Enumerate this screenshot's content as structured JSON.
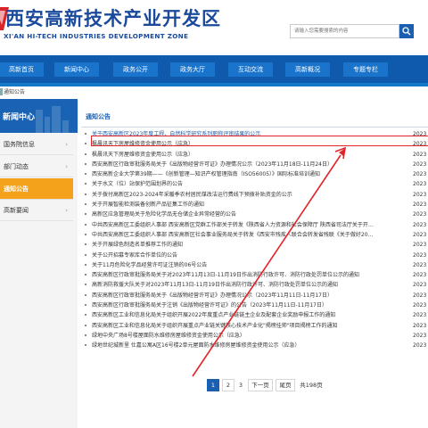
{
  "header": {
    "title_cn": "西安高新技术产业开发区",
    "title_en": "XI'AN HI-TECH INDUSTRIES DEVELOPMENT ZONE",
    "logo_icon": "emblem-icon"
  },
  "search": {
    "placeholder": "请输入您需要搜索的内容",
    "button_icon": "search-icon"
  },
  "nav": {
    "items": [
      {
        "label": "高新首页"
      },
      {
        "label": "新闻中心"
      },
      {
        "label": "政务公开"
      },
      {
        "label": "政务大厅"
      },
      {
        "label": "互动交流"
      },
      {
        "label": "高新概况"
      },
      {
        "label": "专题专栏"
      }
    ]
  },
  "breadcrumb": {
    "text": "通知公告"
  },
  "sidebar": {
    "banner_title": "新闻中心",
    "items": [
      {
        "label": "国务院信息",
        "arrow": "›",
        "active": false
      },
      {
        "label": "部门动态",
        "arrow": "›",
        "active": false
      },
      {
        "label": "通知公告",
        "arrow": "›",
        "active": true
      },
      {
        "label": "高新要闻",
        "arrow": "›",
        "active": false
      }
    ]
  },
  "main": {
    "section_title": "通知公告",
    "articles": [
      {
        "title": "关于西安高新区2023年度工程、自然科学研究系列职称评审结果的公示",
        "date": "2023",
        "highlight": true
      },
      {
        "title": "枫晨讯天下房屋维修资金使用公示（应急）",
        "date": "2023"
      },
      {
        "title": "枫晨讯天下房屋维修资金使用公示（应急）",
        "date": "2023"
      },
      {
        "title": "西安高新区行政审批服务局关于《出版物经营许可证》办理情况公示（2023年11月18日-11月24日）",
        "date": "2023"
      },
      {
        "title": "西安高新企业大学第39期——《创新管理—知识产权管理指南（ISO56005）》国际标准培训通知",
        "date": "2023"
      },
      {
        "title": "关于水文（位）站保护范围划界的公告",
        "date": "2023"
      },
      {
        "title": "关于拨付高新区2023-2024年采暖季农村居民煤改洁运行费线下预拨补贴资金的公示",
        "date": "2023"
      },
      {
        "title": "关于开展智能检测装备创新产品征集工作的通知",
        "date": "2023"
      },
      {
        "title": "高新区应急管理局关于危险化学品无仓储企业异常经营的公告",
        "date": "2023"
      },
      {
        "title": "中共西安高新区工委组织人事部 西安高新区党群工作部关于转发《陕西省人力资源和社会保障厅 陕西省司法厅关于开…",
        "date": "2023"
      },
      {
        "title": "中共西安高新区工委组织人事部 西安高新区社会事业服务局关于转发《西安市残疾人联合会转发省残联《关于做好20…",
        "date": "2023"
      },
      {
        "title": "关于开展绿色制造名单推荐工作的通知",
        "date": "2023"
      },
      {
        "title": "关于公开招募专家库合作单位的公告",
        "date": "2023"
      },
      {
        "title": "关于11月危险化学品经营许可证注销的06号公告",
        "date": "2023"
      },
      {
        "title": "西安高新区行政审批服务局关于对2023年11月13日-11月19日作出消防行政许可、消防行政处罚单位公示的通知",
        "date": "2023"
      },
      {
        "title": "高新消防救援大队关于对2023年11月13日-11月19日作出消防行政许可、消防行政处罚单位公示的通知",
        "date": "2023"
      },
      {
        "title": "西安高新区行政审批服务局关于《出版物经营许可证》办理情况公示（2023年11月11日-11月17日）",
        "date": "2023"
      },
      {
        "title": "西安高新区行政审批服务局关于注销《出版物经营许可证》的公告（2023年11月11日-11月17日）",
        "date": "2023"
      },
      {
        "title": "西安高新区工业和信息化局关于组织开展2022年度重点产业链链主企业及配套企业奖励申报工作的通知",
        "date": "2023"
      },
      {
        "title": "西安高新区工业和信息化局关于组织开展重点产业链关键核心技术产业化\"揭榜挂帅\"项目揭榜工作的通知",
        "date": "2023"
      },
      {
        "title": "绿地中央广场8号楼屋面防水维修房屋维修资金使用公示（应急）",
        "date": "2023"
      },
      {
        "title": "绿地世纪城新里 仕嘉公寓A区16号楼2单元屋面防水维修房屋维修资金使用公示（应急）",
        "date": "2023"
      }
    ]
  },
  "pagination": {
    "pages": [
      "1",
      "2",
      "3"
    ],
    "current": "1",
    "next_label": "下一页",
    "last_label": "尾页",
    "total_label": "共198页"
  },
  "colors": {
    "brand_blue": "#0f5aad",
    "active_orange": "#f4a21c",
    "annotation_red": "#e0242a"
  }
}
